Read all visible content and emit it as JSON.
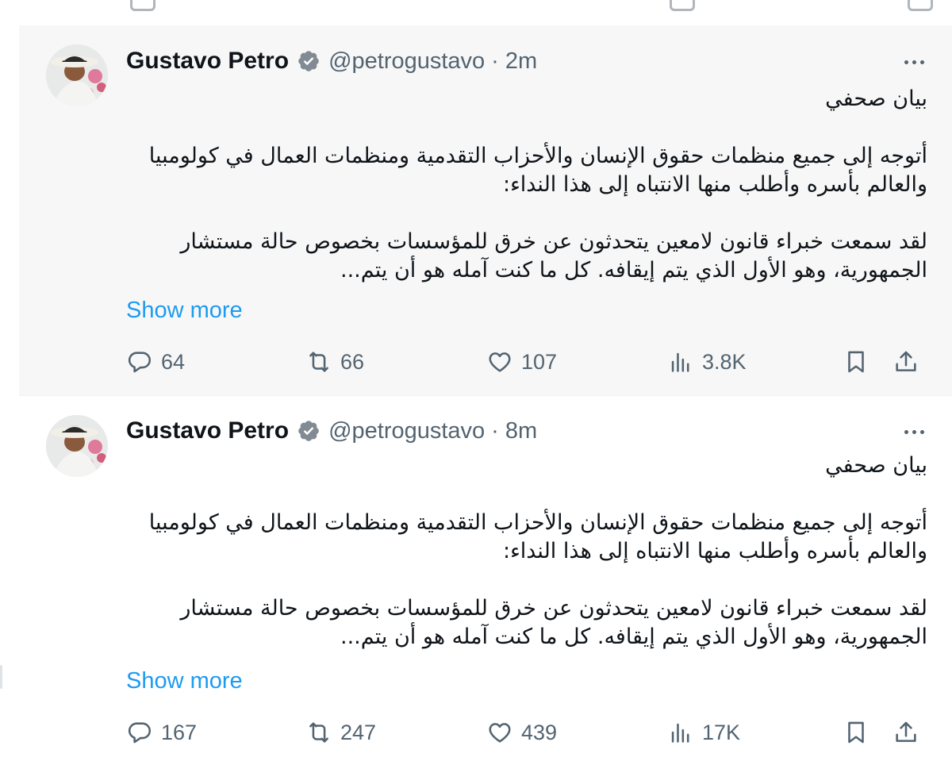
{
  "tweets": [
    {
      "author": "Gustavo Petro",
      "handle": "@petrogustavo",
      "separator": "·",
      "time": "2m",
      "body": {
        "title": "بيان صحفي",
        "para1": "أتوجه إلى جميع منظمات حقوق الإنسان والأحزاب التقدمية ومنظمات العمال في كولومبيا والعالم بأسره وأطلب منها الانتباه إلى هذا النداء:",
        "para2": "لقد سمعت خبراء قانون لامعين يتحدثون عن خرق للمؤسسات بخصوص حالة مستشار الجمهورية، وهو الأول الذي يتم إيقافه. كل ما كنت آمله هو أن يتم..."
      },
      "show_more": "Show more",
      "stats": {
        "replies": "64",
        "reposts": "66",
        "likes": "107",
        "views": "3.8K"
      }
    },
    {
      "author": "Gustavo Petro",
      "handle": "@petrogustavo",
      "separator": "·",
      "time": "8m",
      "body": {
        "title": "بيان صحفي",
        "para1": "أتوجه إلى جميع منظمات حقوق الإنسان والأحزاب التقدمية ومنظمات العمال في كولومبيا والعالم بأسره وأطلب منها الانتباه إلى هذا النداء:",
        "para2": "لقد سمعت خبراء قانون لامعين يتحدثون عن خرق للمؤسسات بخصوص حالة مستشار الجمهورية، وهو الأول الذي يتم إيقافه. كل ما كنت آمله هو أن يتم..."
      },
      "show_more": "Show more",
      "stats": {
        "replies": "167",
        "reposts": "247",
        "likes": "439",
        "views": "17K"
      }
    }
  ],
  "icons": {
    "verified": "verified-badge-icon",
    "more": "more-options-icon",
    "reply": "reply-icon",
    "repost": "repost-icon",
    "like": "heart-icon",
    "views": "views-icon",
    "bookmark": "bookmark-icon",
    "share": "share-icon"
  },
  "colors": {
    "link": "#1d9bf0",
    "muted": "#536471",
    "highlight_bg": "#f7f7f7"
  }
}
